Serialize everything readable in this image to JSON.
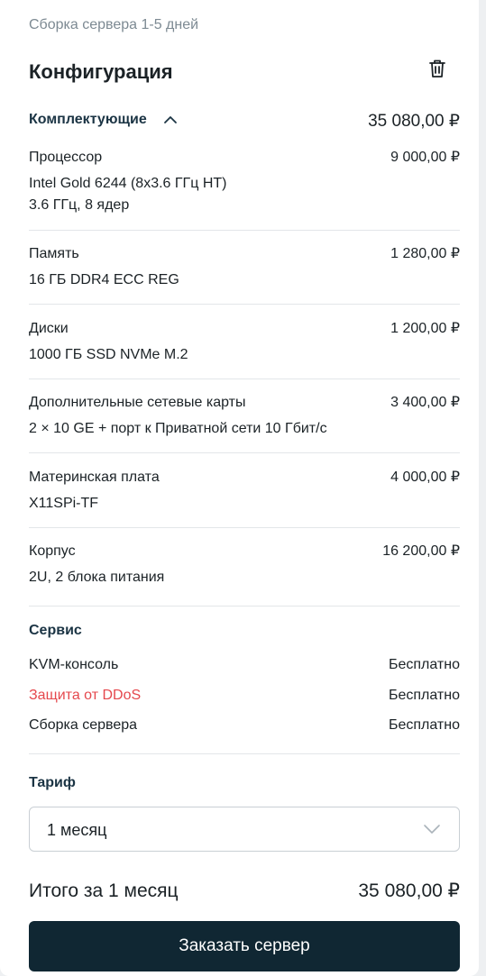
{
  "header": {
    "assembly_note": "Сборка сервера 1-5 дней",
    "title": "Конфигурация",
    "delete_icon": "trash-icon"
  },
  "components": {
    "title": "Комплектующие",
    "collapse_icon": "chevron-up-icon",
    "total": "35 080,00 ₽",
    "items": [
      {
        "name": "Процессор",
        "desc1": "Intel Gold 6244 (8x3.6 ГГц HT)",
        "desc2": "3.6 ГГц, 8 ядер",
        "price": "9 000,00 ₽"
      },
      {
        "name": "Память",
        "desc1": "16 ГБ DDR4 ECC REG",
        "price": "1 280,00 ₽"
      },
      {
        "name": "Диски",
        "desc1": "1000 ГБ SSD NVMe M.2",
        "price": "1 200,00 ₽"
      },
      {
        "name": "Дополнительные сетевые карты",
        "desc1": "2 × 10 GE + порт к Приватной сети 10 Гбит/с",
        "price": "3 400,00 ₽"
      },
      {
        "name": "Материнская плата",
        "desc1": "X11SPi-TF",
        "price": "4 000,00 ₽"
      },
      {
        "name": "Корпус",
        "desc1": "2U, 2 блока питания",
        "price": "16 200,00 ₽"
      }
    ]
  },
  "service": {
    "title": "Сервис",
    "rows": [
      {
        "name": "KVM-консоль",
        "value": "Бесплатно"
      },
      {
        "name": "Защита от DDoS",
        "value": "Бесплатно"
      },
      {
        "name": "Сборка сервера",
        "value": "Бесплатно"
      }
    ]
  },
  "tariff": {
    "title": "Тариф",
    "selected": "1 месяц",
    "dropdown_icon": "chevron-down-icon"
  },
  "summary": {
    "label": "Итого за 1 месяц",
    "amount": "35 080,00 ₽"
  },
  "order_button": "Заказать сервер",
  "colors": {
    "accent_dark": "#102733",
    "ddos_red": "#e5484d",
    "muted": "#7d8a93"
  }
}
